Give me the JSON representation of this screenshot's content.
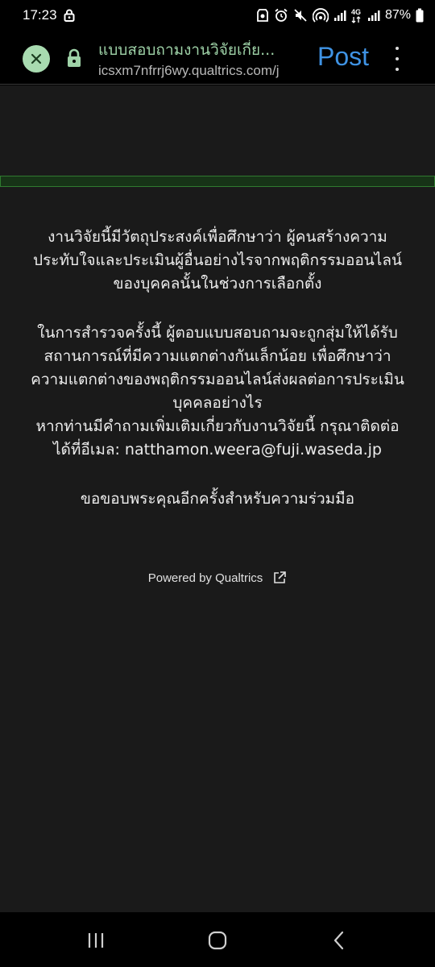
{
  "status_bar": {
    "time": "17:23",
    "battery": "87%",
    "network": "4G"
  },
  "toolbar": {
    "title": "แบบสอบถามงานวิจัยเกี่ย...",
    "url": "icsxm7nfrrj6wy.qualtrics.com/j",
    "post_label": "Post"
  },
  "progress": {
    "fraction": 0.0
  },
  "survey": {
    "paragraph1": [
      "งานวิจัยนี้มีวัตถุประสงค์เพื่อศึกษาว่า ผู้คนสร้างความ",
      "ประทับใจและประเมินผู้อื่นอย่างไรจากพฤติกรรมออนไลน์",
      "ของบุคคลนั้นในช่วงการเลือกตั้ง"
    ],
    "paragraph2": [
      "ในการสำรวจครั้งนี้ ผู้ตอบแบบสอบถามจะถูกสุ่มให้ได้รับ",
      "สถานการณ์ที่มีความแตกต่างกันเล็กน้อย เพื่อศึกษาว่า",
      "ความแตกต่างของพฤติกรรมออนไลน์ส่งผลต่อการประเมิน",
      "บุคคลอย่างไร",
      "หากท่านมีคำถามเพิ่มเติมเกี่ยวกับงานวิจัยนี้ กรุณาติดต่อ",
      "ได้ที่อีเมล: natthamon.weera@fuji.waseda.jp"
    ],
    "paragraph3": [
      "ขอขอบพระคุณอีกครั้งสำหรับความร่วมมือ"
    ]
  },
  "footer": {
    "powered_by": "Powered by Qualtrics"
  },
  "colors": {
    "background": "#1a1a1a",
    "accent_green": "#9fd3a8",
    "post_blue": "#3f93e4"
  }
}
